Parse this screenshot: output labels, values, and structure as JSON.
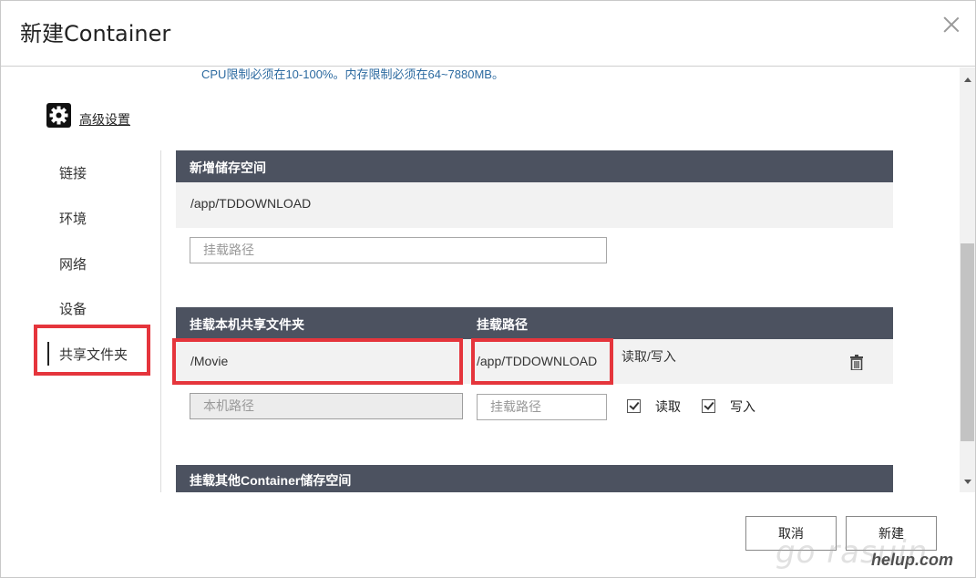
{
  "dialog": {
    "title": "新建Container",
    "hint": "CPU限制必须在10-100%。内存限制必须在64~7880MB。",
    "advanced_label": "高级设置"
  },
  "nav": {
    "items": [
      {
        "label": "链接"
      },
      {
        "label": "环境"
      },
      {
        "label": "网络"
      },
      {
        "label": "设备"
      },
      {
        "label": "共享文件夹"
      }
    ],
    "active": "共享文件夹"
  },
  "new_storage": {
    "header": "新增储存空间",
    "existing_path": "/app/TDDOWNLOAD",
    "mount_placeholder": "挂载路径"
  },
  "shared_folder": {
    "header_local": "挂载本机共享文件夹",
    "header_mount": "挂载路径",
    "row": {
      "local": "/Movie",
      "mount": "/app/TDDOWNLOAD",
      "permission": "读取/写入"
    },
    "local_placeholder": "本机路径",
    "mount_placeholder": "挂载路径",
    "read_label": "读取",
    "write_label": "写入",
    "read_checked": true,
    "write_checked": true
  },
  "other_storage": {
    "header": "挂载其他Container储存空间"
  },
  "buttons": {
    "cancel": "取消",
    "create": "新建"
  },
  "watermark": {
    "logo_text": "go rasuin",
    "sub_text": "helup.com"
  },
  "colors": {
    "section_header_bg": "#4c5260",
    "highlight_red": "#e5353c",
    "hint_blue": "#2c6aa0"
  }
}
